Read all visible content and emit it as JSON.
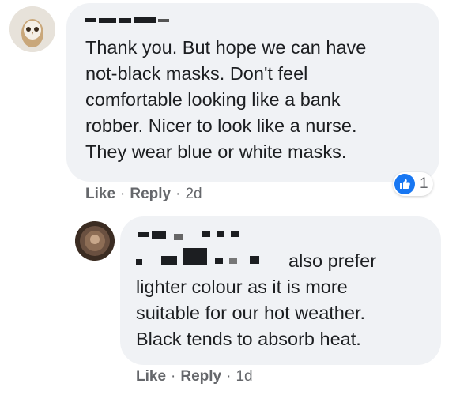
{
  "comment1": {
    "text": "Thank you. But hope we can have\nnot-black masks. Don't feel\ncomfortable looking like a bank\nrobber. Nicer to look like a nurse.\nThey wear blue or white masks.",
    "reaction_icon": "thumbs-up-icon",
    "reaction_count": "1",
    "actions": {
      "like": "Like",
      "reply": "Reply",
      "time": "2d",
      "sep": "·"
    }
  },
  "comment2": {
    "first_line_text": "also prefer",
    "text": "lighter colour as it is more\nsuitable for our hot weather.\nBlack tends to absorb heat.",
    "actions": {
      "like": "Like",
      "reply": "Reply",
      "time": "1d",
      "sep": "·"
    }
  },
  "colors": {
    "bubble": "#f0f2f5",
    "text": "#1c1e21",
    "meta": "#65676b",
    "like_blue": "#1877f2"
  }
}
